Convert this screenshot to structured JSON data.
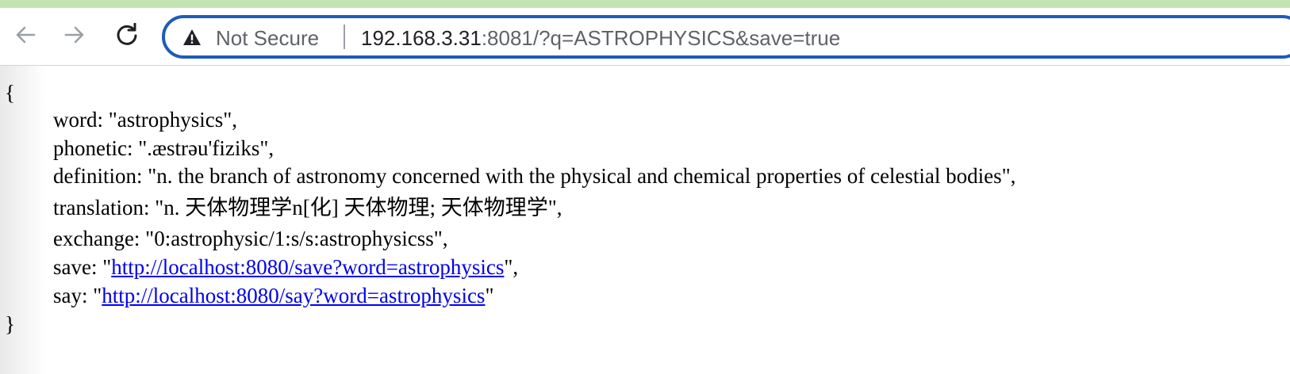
{
  "browser": {
    "back_icon": "arrow-left-icon",
    "forward_icon": "arrow-right-icon",
    "reload_icon": "reload-icon",
    "security_icon": "warning-triangle-icon",
    "security_label": "Not Secure",
    "url_host": "192.168.3.31",
    "url_rest": ":8081/?q=ASTROPHYSICS&save=true",
    "accent_color": "#1f5bb8"
  },
  "json_view": {
    "open_brace": "{",
    "close_brace": "}",
    "word": {
      "prefix": "word: \"",
      "value": "astrophysics",
      "suffix": "\","
    },
    "phonetic": {
      "prefix": "phonetic: \"",
      "value": ".æstrəu'fiziks",
      "suffix": "\","
    },
    "definition": {
      "prefix": "definition: \"",
      "value": "n. the branch of astronomy concerned with the physical and chemical properties of celestial bodies",
      "suffix": "\","
    },
    "translation": {
      "prefix": "translation: \"",
      "value": "n. 天体物理学n[化] 天体物理; 天体物理学",
      "suffix": "\","
    },
    "exchange": {
      "prefix": "exchange: \"",
      "value": "0:astrophysic/1:s/s:astrophysicss",
      "suffix": "\","
    },
    "save": {
      "prefix": "save: \"",
      "link": "http://localhost:8080/save?word=astrophysics",
      "suffix": "\","
    },
    "say": {
      "prefix": "say: \"",
      "link": "http://localhost:8080/say?word=astrophysics",
      "suffix": "\""
    }
  }
}
